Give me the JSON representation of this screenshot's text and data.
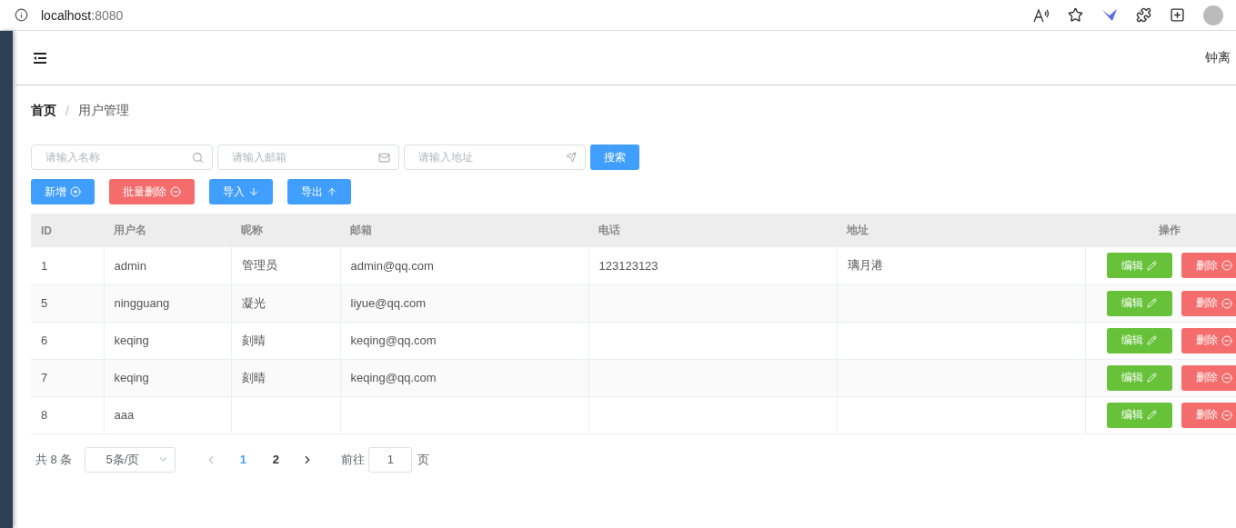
{
  "browser": {
    "host": "localhost",
    "port": ":8080"
  },
  "header": {
    "user": "钟离"
  },
  "breadcrumb": [
    {
      "label": "首页",
      "current": false
    },
    {
      "label": "用户管理",
      "current": true
    }
  ],
  "breadcrumb_separator": "/",
  "search": {
    "fields": [
      {
        "placeholder": "请输入名称"
      },
      {
        "placeholder": "请输入邮箱"
      },
      {
        "placeholder": "请输入地址"
      }
    ],
    "button": "搜索"
  },
  "actions": [
    {
      "label": "新增",
      "kind": "primary"
    },
    {
      "label": "批量删除",
      "kind": "danger"
    },
    {
      "label": "导入",
      "kind": "primary"
    },
    {
      "label": "导出",
      "kind": "primary"
    }
  ],
  "table": {
    "columns": [
      "ID",
      "用户名",
      "昵称",
      "邮箱",
      "电话",
      "地址",
      "操作"
    ],
    "rows": [
      {
        "cells": [
          "1",
          "admin",
          "管理员",
          "admin@qq.com",
          "123123123",
          "璃月港"
        ],
        "edit": "编辑",
        "delete": "删除"
      },
      {
        "cells": [
          "5",
          "ningguang",
          "凝光",
          "liyue@qq.com",
          "",
          ""
        ],
        "edit": "编辑",
        "delete": "删除"
      },
      {
        "cells": [
          "6",
          "keqing",
          "刻晴",
          "keqing@qq.com",
          "",
          ""
        ],
        "edit": "编辑",
        "delete": "删除"
      },
      {
        "cells": [
          "7",
          "keqing",
          "刻晴",
          "keqing@qq.com",
          "",
          ""
        ],
        "edit": "编辑",
        "delete": "删除"
      },
      {
        "cells": [
          "8",
          "aaa",
          "",
          "",
          "",
          ""
        ],
        "edit": "编辑",
        "delete": "删除"
      }
    ]
  },
  "pagination": {
    "total": "共 8 条",
    "page_size": "5条/页",
    "pages": [
      {
        "label": "1",
        "selected": true
      },
      {
        "label": "2",
        "selected": false
      }
    ],
    "goto": "前往",
    "goto_value": "1",
    "page_unit": "页"
  }
}
